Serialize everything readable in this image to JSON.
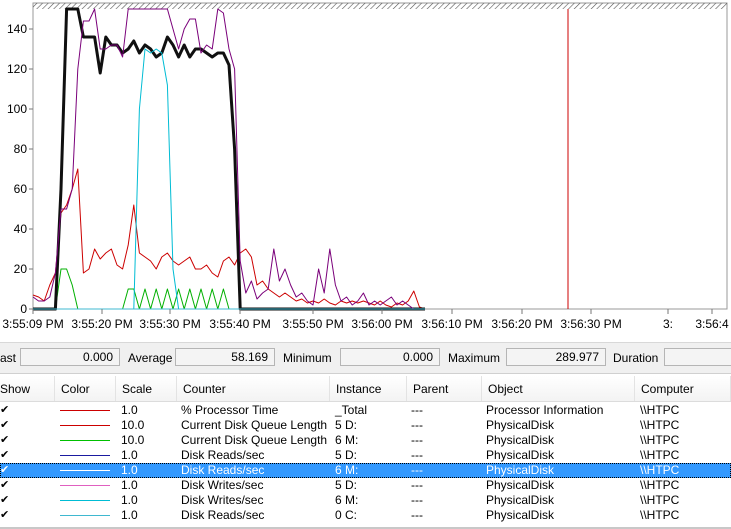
{
  "chart_data": {
    "type": "line",
    "y_ticks": [
      "0",
      "20",
      "40",
      "60",
      "80",
      "100",
      "120",
      "140"
    ],
    "ylim": [
      0,
      150
    ],
    "x_ticks": [
      "3:55:09 PM",
      "3:55:20 PM",
      "3:55:30 PM",
      "3:55:40 PM",
      "3:55:50 PM",
      "3:56:00 PM",
      "3:56:10 PM",
      "3:56:20 PM",
      "3:56:30 PM",
      "3:",
      "3:56:4"
    ],
    "grid": false,
    "time_marker_color": "#cc0000",
    "series": [
      {
        "name": "% Processor Time",
        "color": "#cc0000",
        "values": [
          7,
          6,
          4,
          12,
          18,
          48,
          52,
          60,
          70,
          18,
          20,
          30,
          25,
          28,
          30,
          22,
          20,
          32,
          52,
          28,
          26,
          24,
          20,
          26,
          28,
          24,
          22,
          24,
          26,
          20,
          20,
          22,
          18,
          16,
          24,
          26,
          22,
          28,
          30,
          26,
          12,
          14,
          10,
          8,
          6,
          8,
          6,
          4,
          5,
          3,
          4,
          3,
          5,
          3,
          2,
          4,
          3,
          4,
          3,
          4,
          3,
          2,
          4,
          2,
          1,
          3,
          2,
          4,
          9,
          1,
          0
        ]
      },
      {
        "name": "Current Disk Queue Length",
        "color": "#00b000",
        "values": [
          0,
          0,
          0,
          0,
          0,
          20,
          20,
          12,
          0,
          0,
          0,
          0,
          0,
          0,
          0,
          0,
          0,
          10,
          10,
          0,
          10,
          0,
          10,
          0,
          10,
          0,
          10,
          0,
          10,
          0,
          10,
          0,
          10,
          0,
          10,
          0,
          0,
          0,
          0,
          0,
          0,
          0,
          0,
          0,
          0,
          0,
          0,
          0,
          0,
          0,
          0,
          0,
          0,
          0,
          0,
          0,
          0,
          0,
          0,
          0,
          0,
          0,
          0,
          0,
          0,
          0,
          0,
          0,
          0,
          0,
          0
        ]
      },
      {
        "name": "Disk Reads/sec",
        "color": "#1a1aa0",
        "values": [
          0,
          0,
          0,
          0,
          0,
          0,
          0,
          0,
          0,
          0,
          0,
          0,
          0,
          0,
          0,
          0,
          0,
          0,
          0,
          0,
          0,
          0,
          0,
          0,
          0,
          0,
          0,
          0,
          0,
          0,
          0,
          0,
          0,
          0,
          0,
          0,
          0,
          0,
          0,
          0,
          0,
          0,
          0,
          0,
          0,
          0,
          0,
          0,
          0,
          0,
          0,
          0,
          0,
          0,
          0,
          0,
          0,
          0,
          0,
          0,
          0,
          0,
          0,
          0,
          0,
          0,
          0,
          0,
          0,
          0,
          0
        ]
      },
      {
        "name": "Disk Reads/sec (6 M:)",
        "color": "#101010",
        "values": [
          0,
          0,
          0,
          0,
          0,
          60,
          150,
          150,
          150,
          136,
          136,
          136,
          118,
          136,
          132,
          132,
          128,
          130,
          134,
          128,
          132,
          130,
          126,
          128,
          136,
          132,
          126,
          132,
          126,
          130,
          130,
          128,
          126,
          128,
          128,
          122,
          80,
          0,
          0,
          0,
          0,
          0,
          0,
          0,
          0,
          0,
          0,
          0,
          0,
          0,
          0,
          0,
          0,
          0,
          0,
          0,
          0,
          0,
          0,
          0,
          0,
          0,
          0,
          0,
          0,
          0,
          0,
          0,
          0,
          0,
          0
        ]
      },
      {
        "name": "Disk Writes/sec",
        "color": "#7a007a",
        "values": [
          6,
          4,
          4,
          6,
          18,
          50,
          50,
          60,
          120,
          144,
          144,
          150,
          130,
          130,
          132,
          132,
          126,
          150,
          150,
          150,
          150,
          150,
          150,
          150,
          150,
          140,
          130,
          140,
          145,
          145,
          128,
          132,
          130,
          150,
          148,
          130,
          120,
          24,
          8,
          14,
          5,
          8,
          10,
          30,
          14,
          20,
          12,
          6,
          8,
          4,
          2,
          20,
          8,
          30,
          12,
          4,
          6,
          2,
          4,
          8,
          2,
          4,
          2,
          4,
          6,
          2,
          4,
          2,
          0,
          0,
          0
        ]
      },
      {
        "name": "Disk Writes/sec (6 M:)",
        "color": "#00bcd4",
        "values": [
          0,
          0,
          0,
          0,
          0,
          0,
          0,
          0,
          0,
          0,
          0,
          0,
          0,
          0,
          0,
          0,
          0,
          0,
          0,
          100,
          130,
          128,
          130,
          128,
          112,
          20,
          0,
          0,
          0,
          0,
          0,
          0,
          0,
          0,
          0,
          0,
          0,
          0,
          0,
          0,
          0,
          0,
          0,
          0,
          0,
          0,
          0,
          0,
          0,
          0,
          0,
          0,
          0,
          0,
          0,
          0,
          0,
          0,
          0,
          0,
          0,
          0,
          0,
          0,
          0,
          0,
          0,
          0,
          0,
          0,
          0
        ]
      },
      {
        "name": "Disk Reads/sec (0 C:)",
        "color": "#3fb8d0",
        "values": [
          0,
          0,
          0,
          0,
          0,
          0,
          0,
          0,
          0,
          0,
          0,
          0,
          0,
          0,
          0,
          0,
          0,
          0,
          0,
          0,
          0,
          0,
          0,
          0,
          0,
          0,
          0,
          0,
          0,
          0,
          0,
          0,
          0,
          0,
          0,
          0,
          0,
          0,
          0,
          0,
          0,
          0,
          0,
          0,
          0,
          0,
          0,
          0,
          0,
          0,
          0,
          0,
          0,
          0,
          0,
          0,
          0,
          0,
          0,
          0,
          0,
          0,
          0,
          0,
          0,
          0,
          0,
          0,
          0,
          0,
          0
        ]
      }
    ]
  },
  "stats": {
    "last_label": "ast",
    "last_value": "0.000",
    "average_label": "Average",
    "average_value": "58.169",
    "minimum_label": "Minimum",
    "minimum_value": "0.000",
    "maximum_label": "Maximum",
    "maximum_value": "289.977",
    "duration_label": "Duration",
    "duration_value": ""
  },
  "table": {
    "headers": {
      "show": "Show",
      "color": "Color",
      "scale": "Scale",
      "counter": "Counter",
      "instance": "Instance",
      "parent": "Parent",
      "object": "Object",
      "computer": "Computer"
    },
    "rows": [
      {
        "checked": "✔",
        "color": "#cc0000",
        "scale": "1.0",
        "counter": "% Processor Time",
        "instance": "_Total",
        "parent": "---",
        "object": "Processor Information",
        "computer": "\\\\HTPC",
        "selected": false
      },
      {
        "checked": "✔",
        "color": "#cc0000",
        "scale": "10.0",
        "counter": "Current Disk Queue Length",
        "instance": "5 D:",
        "parent": "---",
        "object": "PhysicalDisk",
        "computer": "\\\\HTPC",
        "selected": false
      },
      {
        "checked": "✔",
        "color": "#00c000",
        "scale": "10.0",
        "counter": "Current Disk Queue Length",
        "instance": "6 M:",
        "parent": "---",
        "object": "PhysicalDisk",
        "computer": "\\\\HTPC",
        "selected": false
      },
      {
        "checked": "✔",
        "color": "#1a1aa0",
        "scale": "1.0",
        "counter": "Disk Reads/sec",
        "instance": "5 D:",
        "parent": "---",
        "object": "PhysicalDisk",
        "computer": "\\\\HTPC",
        "selected": false
      },
      {
        "checked": "✔",
        "color": "#ffffff",
        "scale": "1.0",
        "counter": "Disk Reads/sec",
        "instance": "6 M:",
        "parent": "---",
        "object": "PhysicalDisk",
        "computer": "\\\\HTPC",
        "selected": true
      },
      {
        "checked": "✔",
        "color": "#e060c0",
        "scale": "1.0",
        "counter": "Disk Writes/sec",
        "instance": "5 D:",
        "parent": "---",
        "object": "PhysicalDisk",
        "computer": "\\\\HTPC",
        "selected": false
      },
      {
        "checked": "✔",
        "color": "#00bcd4",
        "scale": "1.0",
        "counter": "Disk Writes/sec",
        "instance": "6 M:",
        "parent": "---",
        "object": "PhysicalDisk",
        "computer": "\\\\HTPC",
        "selected": false
      },
      {
        "checked": "✔",
        "color": "#3fb8d0",
        "scale": "1.0",
        "counter": "Disk Reads/sec",
        "instance": "0 C:",
        "parent": "---",
        "object": "PhysicalDisk",
        "computer": "\\\\HTPC",
        "selected": false
      }
    ]
  }
}
